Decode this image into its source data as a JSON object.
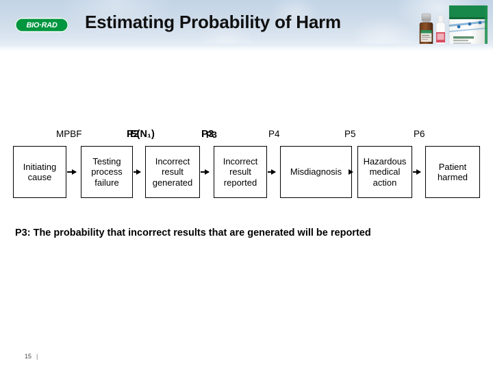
{
  "header": {
    "title": "Estimating Probability of Harm",
    "logo_text": "BIO·RAD",
    "logo_color": "#00963f",
    "band_color": "#cfdcea",
    "product_image_alt": "product-vials-and-box"
  },
  "diagram": {
    "labels": [
      {
        "text": "MPBF",
        "bold": false,
        "overlap": null
      },
      {
        "text": "P2",
        "bold": true,
        "overlap": "E(N₁)"
      },
      {
        "text": "P3",
        "bold": true,
        "overlap": "P3"
      },
      {
        "text": "P4",
        "bold": false,
        "overlap": null
      },
      {
        "text": "P5",
        "bold": false,
        "overlap": null
      },
      {
        "text": "P6",
        "bold": false,
        "overlap": null
      }
    ],
    "boxes": [
      {
        "text": "Initiating cause"
      },
      {
        "text": "Testing process failure"
      },
      {
        "text": "Incorrect result generated"
      },
      {
        "text": "Incorrect result reported"
      },
      {
        "text": "Misdiagnosis"
      },
      {
        "text": "Hazardous medical action"
      },
      {
        "text": "Patient harmed"
      }
    ],
    "arrow_count": 6
  },
  "caption": {
    "text": "P3: The probability that incorrect results that are generated will be reported"
  },
  "footer": {
    "slide_number": "15",
    "separator": "|"
  }
}
